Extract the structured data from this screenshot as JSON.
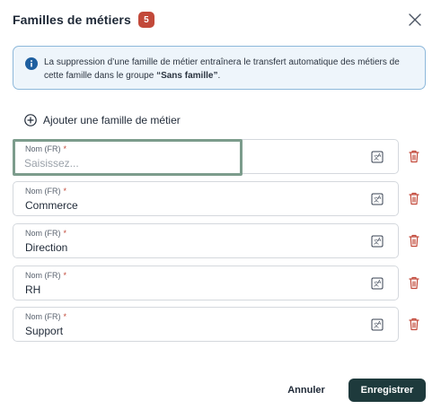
{
  "header": {
    "title": "Familles de métiers",
    "count": "5"
  },
  "info": {
    "text_before": "La suppression d’une famille de métier entraînera le transfert automatique des métiers de cette famille dans le groupe ",
    "text_strong": "“Sans famille”",
    "text_after": ".",
    "icon": "info-icon"
  },
  "add": {
    "label": "Ajouter une famille de métier",
    "icon": "plus-circle-icon"
  },
  "fields": [
    {
      "label": "Nom (FR)",
      "required": "*",
      "value": "",
      "placeholder": "Saisissez..."
    },
    {
      "label": "Nom (FR)",
      "required": "*",
      "value": "Commerce"
    },
    {
      "label": "Nom (FR)",
      "required": "*",
      "value": "Direction"
    },
    {
      "label": "Nom (FR)",
      "required": "*",
      "value": "RH"
    },
    {
      "label": "Nom (FR)",
      "required": "*",
      "value": "Support"
    }
  ],
  "footer": {
    "cancel_label": "Annuler",
    "save_label": "Enregistrer"
  },
  "colors": {
    "badge": "#c2493a",
    "primary": "#1e3a3c",
    "info_bg": "#eef5fb",
    "info_border": "#8db8da",
    "delete": "#c2493a",
    "focus": "#7c9c8c"
  }
}
